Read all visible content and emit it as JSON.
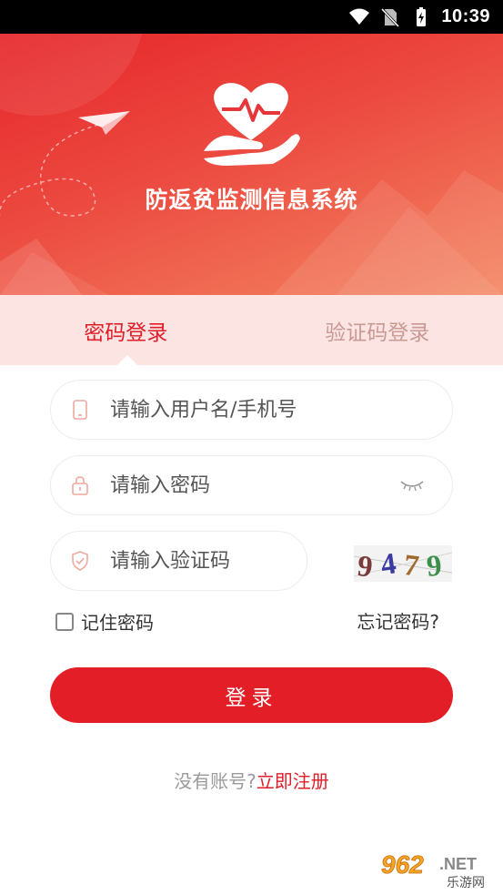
{
  "status_bar": {
    "time": "10:39"
  },
  "app": {
    "title": "防返贫监测信息系统"
  },
  "tabs": [
    {
      "label": "密码登录",
      "active": true
    },
    {
      "label": "验证码登录",
      "active": false
    }
  ],
  "form": {
    "username_placeholder": "请输入用户名/手机号",
    "password_placeholder": "请输入密码",
    "captcha_placeholder": "请输入验证码",
    "captcha_code": "9479",
    "remember_label": "记住密码",
    "forgot_label": "忘记密码?",
    "login_label": "登录",
    "no_account_label": "没有账号?",
    "register_label": "立即注册"
  },
  "watermark": {
    "number": "962",
    "suffix": ".NET",
    "sub": "乐游网"
  },
  "colors": {
    "primary": "#e31e26",
    "tab_bg": "#fbe4e1",
    "inactive_tab": "#c99a95"
  }
}
